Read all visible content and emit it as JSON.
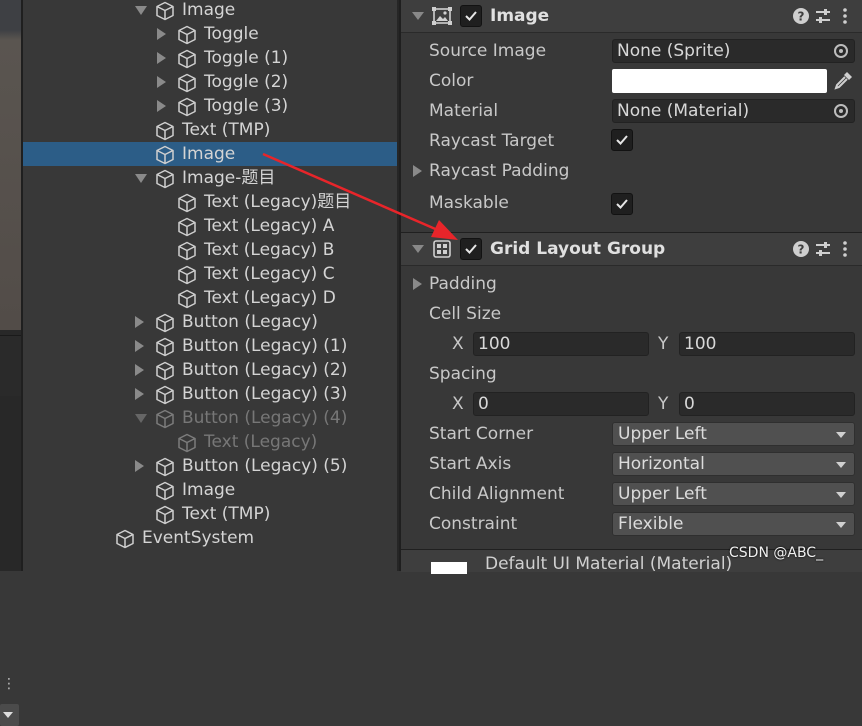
{
  "hierarchy": {
    "rows": [
      {
        "label": "Image",
        "depth": 2,
        "arrow": "down"
      },
      {
        "label": "Toggle",
        "depth": 3,
        "arrow": "right"
      },
      {
        "label": "Toggle (1)",
        "depth": 3,
        "arrow": "right"
      },
      {
        "label": "Toggle (2)",
        "depth": 3,
        "arrow": "right"
      },
      {
        "label": "Toggle (3)",
        "depth": 3,
        "arrow": "right"
      },
      {
        "label": "Text (TMP)",
        "depth": 2,
        "arrow": "none"
      },
      {
        "label": "Image",
        "depth": 2,
        "arrow": "none",
        "selected": true
      },
      {
        "label": "Image-题目",
        "depth": 2,
        "arrow": "down"
      },
      {
        "label": "Text (Legacy)题目",
        "depth": 3,
        "arrow": "none"
      },
      {
        "label": "Text (Legacy) A",
        "depth": 3,
        "arrow": "none"
      },
      {
        "label": "Text (Legacy) B",
        "depth": 3,
        "arrow": "none"
      },
      {
        "label": "Text (Legacy) C",
        "depth": 3,
        "arrow": "none"
      },
      {
        "label": "Text (Legacy) D",
        "depth": 3,
        "arrow": "none"
      },
      {
        "label": "Button (Legacy)",
        "depth": 2,
        "arrow": "right"
      },
      {
        "label": "Button (Legacy) (1)",
        "depth": 2,
        "arrow": "right"
      },
      {
        "label": "Button (Legacy) (2)",
        "depth": 2,
        "arrow": "right"
      },
      {
        "label": "Button (Legacy) (3)",
        "depth": 2,
        "arrow": "right"
      },
      {
        "label": "Button (Legacy) (4)",
        "depth": 2,
        "arrow": "down",
        "dim": true
      },
      {
        "label": "Text (Legacy)",
        "depth": 3,
        "arrow": "none",
        "dim": true
      },
      {
        "label": "Button (Legacy) (5)",
        "depth": 2,
        "arrow": "right"
      },
      {
        "label": "Image",
        "depth": 2,
        "arrow": "none"
      },
      {
        "label": "Text (TMP)",
        "depth": 2,
        "arrow": "none"
      },
      {
        "label": "EventSystem",
        "depth": 1,
        "arrow": "none"
      }
    ]
  },
  "image_component": {
    "title": "Image",
    "enabled": true,
    "source_image_label": "Source Image",
    "source_image_value": "None (Sprite)",
    "color_label": "Color",
    "color_value": "#ffffff",
    "material_label": "Material",
    "material_value": "None (Material)",
    "raycast_target_label": "Raycast Target",
    "raycast_target": true,
    "raycast_padding_label": "Raycast Padding",
    "maskable_label": "Maskable",
    "maskable": true
  },
  "grid_layout_component": {
    "title": "Grid Layout Group",
    "enabled": true,
    "padding_label": "Padding",
    "cell_size_label": "Cell Size",
    "cell_x_label": "X",
    "cell_x": "100",
    "cell_y_label": "Y",
    "cell_y": "100",
    "spacing_label": "Spacing",
    "spacing_x_label": "X",
    "spacing_x": "0",
    "spacing_y_label": "Y",
    "spacing_y": "0",
    "start_corner_label": "Start Corner",
    "start_corner": "Upper Left",
    "start_axis_label": "Start Axis",
    "start_axis": "Horizontal",
    "child_alignment_label": "Child Alignment",
    "child_alignment": "Upper Left",
    "constraint_label": "Constraint",
    "constraint": "Flexible"
  },
  "material_preview": {
    "label": "Default UI Material (Material)"
  },
  "watermark": "CSDN @ABC_",
  "annotation_color": "#e8252a",
  "selection_color": "#2c5d87"
}
